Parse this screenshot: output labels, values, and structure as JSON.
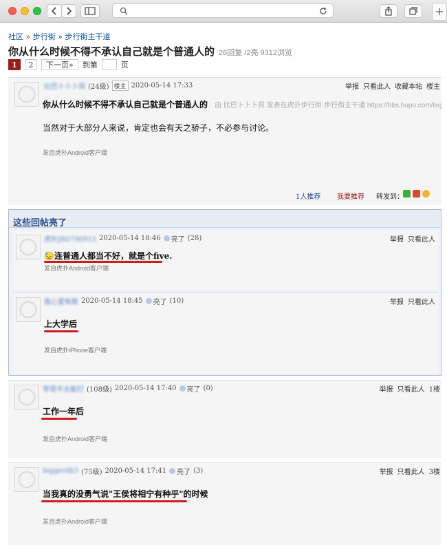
{
  "breadcrumb": [
    "社区",
    "步行街",
    "步行街主干道"
  ],
  "thread": {
    "title": "你从什么时候不得不承认自己就是个普通人的",
    "meta": "26回复 /2亮  9312浏览"
  },
  "pager": {
    "pages": [
      "1",
      "2"
    ],
    "next": "下一页»",
    "goto": "到第",
    "page_unit": "页"
  },
  "op": {
    "user": "比巴卜卜卜貝",
    "level": "(24级)",
    "badge": "楼主",
    "time": "2020-05-14 17:33",
    "ops": [
      "举报",
      "只看此人",
      "收藏本帖",
      "楼主"
    ],
    "title_line": "你从什么时候不得不承认自己就是个普通人的",
    "attribution": "由  比巴卜卜卜貝 发表在虎扑步行街·步行街主干道 https://bbs.hupu.com/bxj",
    "body": "当然对于大部分人来说，肯定也会有天之骄子，不必参与讨论。",
    "source": "发自虎扑Android客户端",
    "recommend_count": "1人推荐",
    "recommend": "我要推荐",
    "share": "转发到："
  },
  "bright": {
    "header": "这些回帖亮了",
    "replies": [
      {
        "user": "虎扑JR0790915",
        "time": "2020-05-14 18:46",
        "lit": "亮了",
        "count": "(28)",
        "ops": [
          "举报",
          "只看此人"
        ],
        "text": "😓连普通人都当不好，就是个five.",
        "source": "发自虎扑Android客户端"
      },
      {
        "user": "我心里有数",
        "time": "2020-05-14 18:45",
        "lit": "亮了",
        "count": "(10)",
        "ops": [
          "举报",
          "只看此人"
        ],
        "text": "上大学后",
        "source": "发自虎扑iPhone客户端"
      }
    ]
  },
  "floors": [
    {
      "user": "李哥不太能打",
      "level": "(108级)",
      "time": "2020-05-14 17:40",
      "lit": "亮了",
      "count": "(0)",
      "ops": [
        "举报",
        "只看此人",
        "1楼"
      ],
      "text": "工作一年后",
      "source": "发自虎扑Android客户端"
    },
    {
      "user": "biggerdk3",
      "level": "(75级)",
      "time": "2020-05-14 17:41",
      "lit": "亮了",
      "count": "(3)",
      "ops": [
        "举报",
        "只看此人",
        "3楼"
      ],
      "text": "当我真的没勇气说\"王侯将相宁有种乎\"的时候",
      "source": "发自虎扑Android客户端"
    }
  ],
  "colors": {
    "underline": "#d11a1a",
    "link": "#0b4fa8",
    "current_page": "#9b1c1c"
  }
}
